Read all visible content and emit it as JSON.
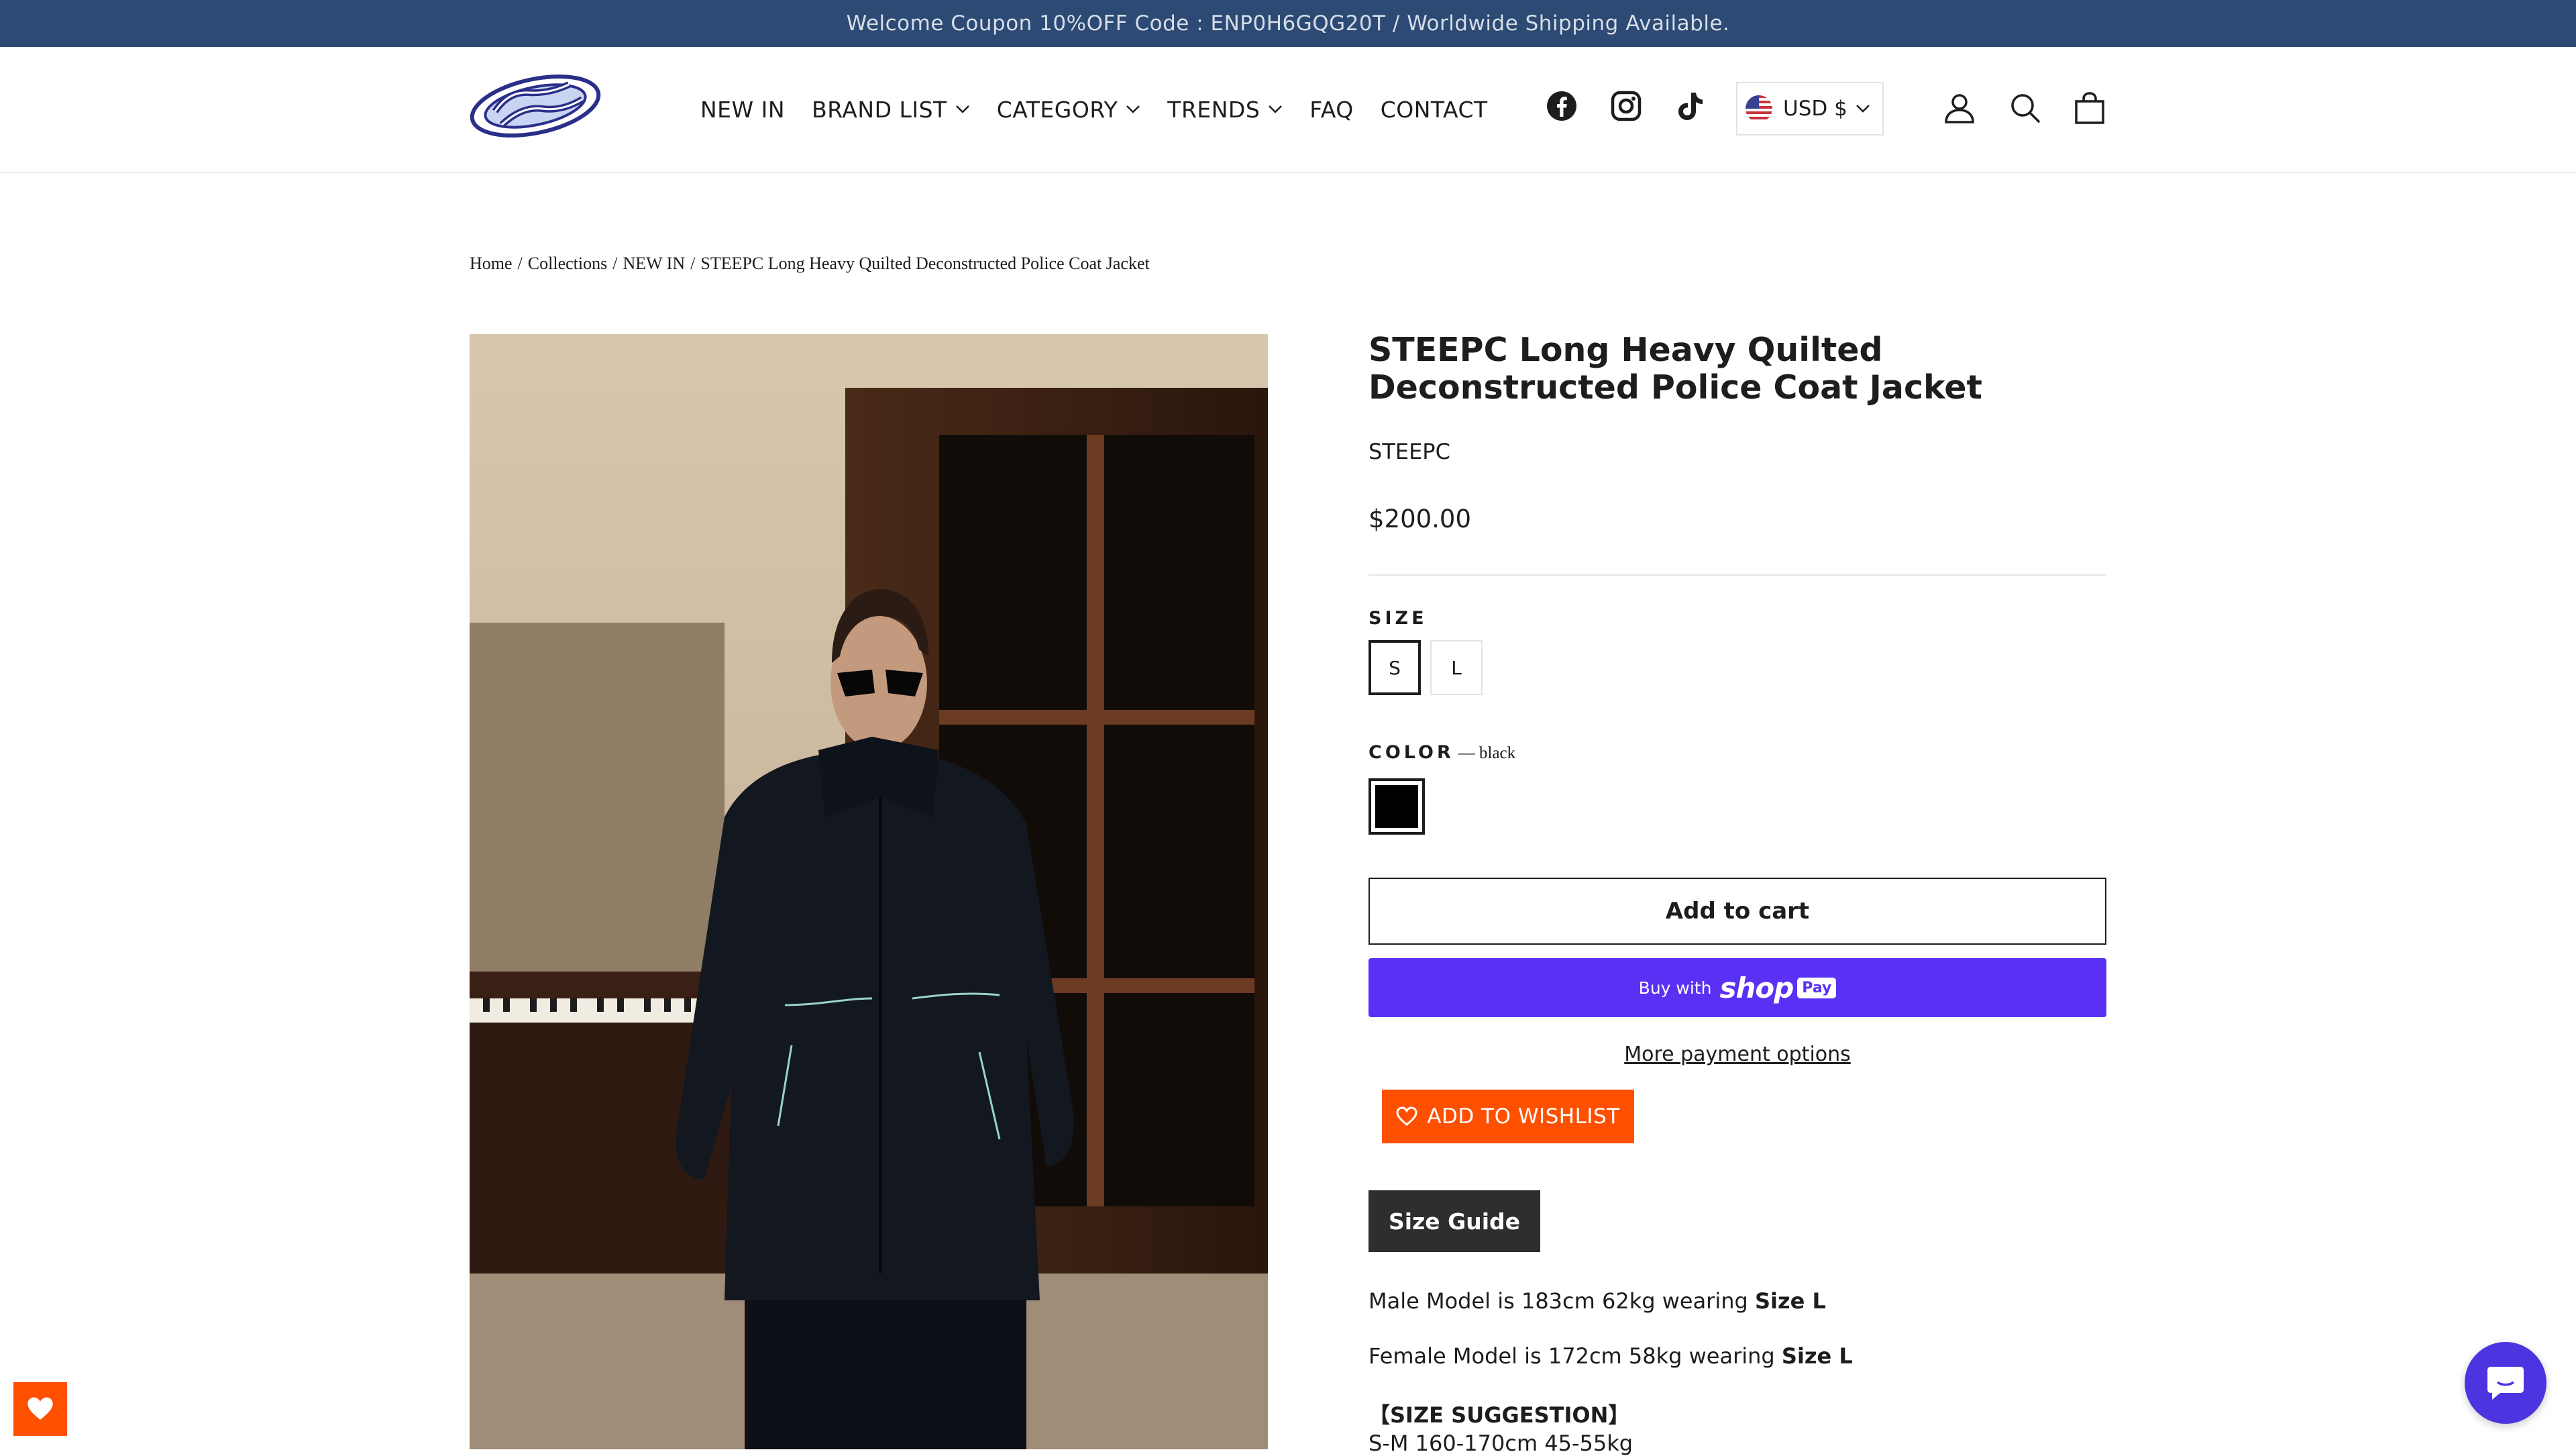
{
  "announcement": "Welcome Coupon 10%OFF Code : ENP0H6GQG20T / Worldwide Shipping Available.",
  "nav": {
    "new_in": "NEW IN",
    "brand_list": "BRAND LIST",
    "category": "CATEGORY",
    "trends": "TRENDS",
    "faq": "FAQ",
    "contact": "CONTACT"
  },
  "social_icons": [
    "facebook-icon",
    "instagram-icon",
    "tiktok-icon"
  ],
  "currency": {
    "label": "USD $",
    "flag": "us-flag-icon"
  },
  "header_icons": [
    "account-icon",
    "search-icon",
    "cart-icon"
  ],
  "breadcrumb": {
    "home": "Home",
    "collections": "Collections",
    "new_in": "NEW IN",
    "current": "STEEPC Long Heavy Quilted Deconstructed Police Coat Jacket",
    "separator": "/"
  },
  "product": {
    "title": "STEEPC Long Heavy Quilted Deconstructed Police Coat Jacket",
    "vendor": "STEEPC",
    "price": "$200.00",
    "size_label": "SIZE",
    "sizes": [
      "S",
      "L"
    ],
    "selected_size": "S",
    "color_label": "COLOR",
    "color_value": "— black",
    "swatch_color": "#000000",
    "add_to_cart": "Add to cart",
    "buy_with": "Buy with",
    "shop_text": "shop",
    "pay_text": "Pay",
    "more_payment": "More payment options",
    "wishlist": "ADD TO WISHLIST",
    "size_guide": "Size Guide",
    "male_model_prefix": "Male Model is 183cm 62kg wearing",
    "male_model_size": "Size L",
    "female_model_prefix": "Female Model is 172cm 58kg wearing",
    "female_model_size": "Size L",
    "size_suggestion_title": "【SIZE SUGGESTION】",
    "size_suggestion_line": "S-M 160-170cm 45-55kg"
  },
  "colors": {
    "announcement_bg": "#2c4a73",
    "accent_orange": "#ff4f00",
    "shop_pay": "#5a31f4",
    "chat": "#4c35e0"
  }
}
